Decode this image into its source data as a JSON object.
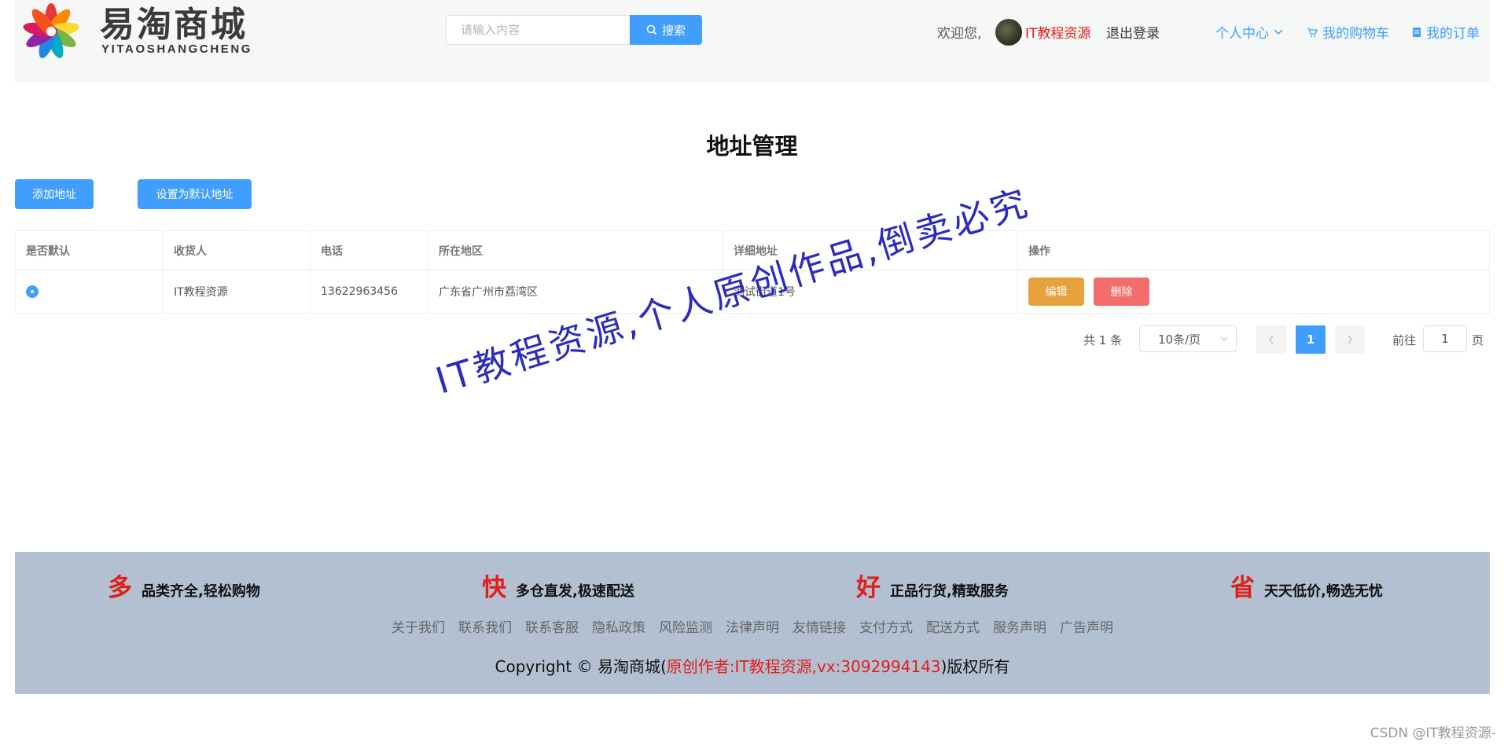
{
  "header": {
    "logo_text": "易淘商城",
    "logo_sub": "YITAOSHANGCHENG",
    "search_placeholder": "请输入内容",
    "search_button": "搜索",
    "welcome": "欢迎您,",
    "username": "IT教程资源",
    "logout": "退出登录",
    "user_center": "个人中心",
    "cart": "我的购物车",
    "orders": "我的订单"
  },
  "main": {
    "title": "地址管理",
    "add_button": "添加地址",
    "default_button": "设置为默认地址",
    "columns": [
      "是否默认",
      "收货人",
      "电话",
      "所在地区",
      "详细地址",
      "操作"
    ],
    "rows": [
      {
        "receiver": "IT教程资源",
        "phone": "13622963456",
        "region": "广东省广州市荔湾区",
        "address": "测试街道1号",
        "is_default": true
      }
    ],
    "edit_button": "编辑",
    "delete_button": "删除"
  },
  "pagination": {
    "total": "共 1 条",
    "page_size": "10条/页",
    "current_page": "1",
    "goto_label": "前往",
    "goto_value": "1",
    "page_unit": "页"
  },
  "watermark": "IT教程资源,个人原创作品,倒卖必究",
  "footer": {
    "features": [
      {
        "big": "多",
        "desc": "品类齐全,轻松购物"
      },
      {
        "big": "快",
        "desc": "多仓直发,极速配送"
      },
      {
        "big": "好",
        "desc": "正品行货,精致服务"
      },
      {
        "big": "省",
        "desc": "天天低价,畅选无忧"
      }
    ],
    "links": [
      "关于我们",
      "联系我们",
      "联系客服",
      "隐私政策",
      "风险监测",
      "法律声明",
      "友情链接",
      "支付方式",
      "配送方式",
      "服务声明",
      "广告声明"
    ],
    "copyright_prefix": "Copyright © 易淘商城(",
    "copyright_highlight": "原创作者:IT教程资源,vx:3092994143",
    "copyright_suffix": ")版权所有"
  },
  "csdn_mark": "CSDN @IT教程资源-",
  "colors": {
    "primary": "#409eff",
    "warning": "#e6a23c",
    "danger": "#f56c6c",
    "footer_bg": "#b3c0d1",
    "accent_red": "#e0201a"
  }
}
